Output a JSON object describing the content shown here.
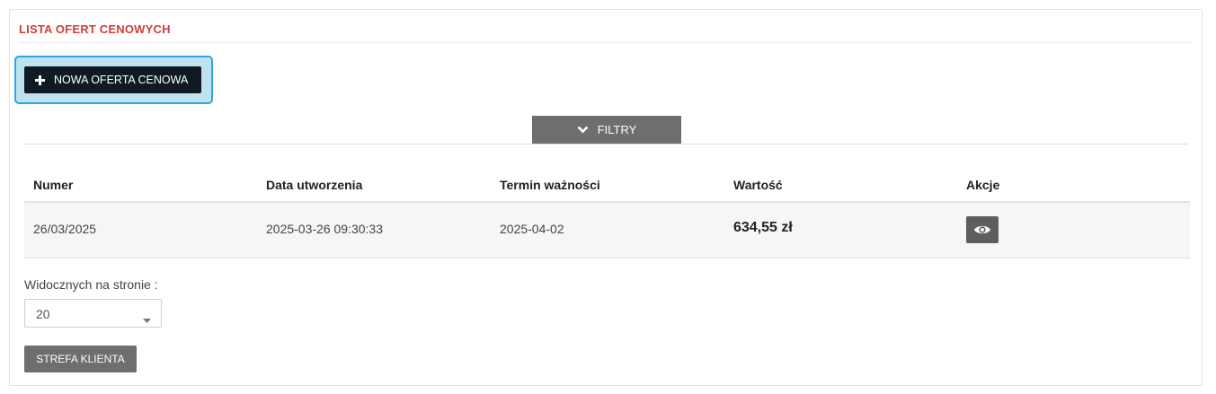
{
  "panel": {
    "title": "LISTA OFERT CENOWYCH"
  },
  "actions": {
    "new_offer_label": "NOWA OFERTA CENOWA"
  },
  "filters": {
    "label": "FILTRY"
  },
  "table": {
    "columns": [
      "Numer",
      "Data utworzenia",
      "Termin ważności",
      "Wartość",
      "Akcje"
    ],
    "rows": [
      {
        "number": "26/03/2025",
        "created": "2025-03-26 09:30:33",
        "valid_until": "2025-04-02",
        "value": "634,55 zł"
      }
    ]
  },
  "pagination": {
    "per_page_label": "Widocznych na stronie :",
    "per_page_value": "20"
  },
  "footer": {
    "client_zone_label": "STREFA KLIENTA"
  },
  "colors": {
    "title_red": "#d23c3c",
    "focus_blue": "#2ba7dc",
    "dark_button": "#0f1a24",
    "gray_button": "#6e6e6e"
  }
}
